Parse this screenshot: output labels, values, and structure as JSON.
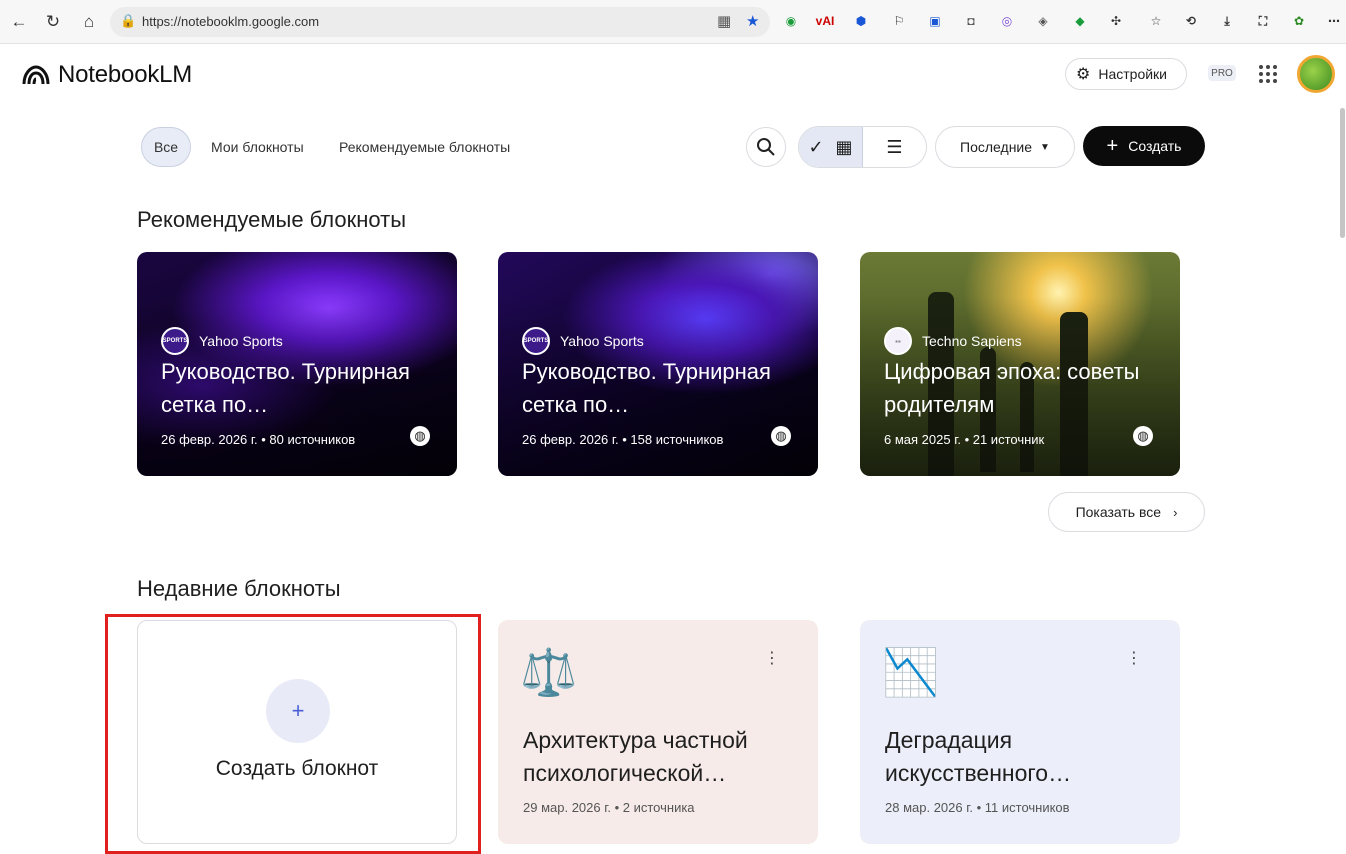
{
  "browser": {
    "url": "https://notebooklm.google.com",
    "ext_vai_label": "vAI"
  },
  "app": {
    "name": "NotebookLM",
    "settings_label": "Настройки",
    "pro_label": "PRO"
  },
  "toolbar": {
    "tabs": [
      {
        "label": "Все",
        "active": true
      },
      {
        "label": "Мои блокноты",
        "active": false
      },
      {
        "label": "Рекомендуемые блокноты",
        "active": false
      }
    ],
    "sort_label": "Последние",
    "create_label": "Создать"
  },
  "featured": {
    "title": "Рекомендуемые блокноты",
    "show_all_label": "Показать все",
    "cards": [
      {
        "source": "Yahoo Sports",
        "source_logo_text": "SPORTS",
        "title": "Руководство. Турнирная сетка по…",
        "meta": "26 февр. 2026 г. • 80 источников"
      },
      {
        "source": "Yahoo Sports",
        "source_logo_text": "SPORTS",
        "title": "Руководство. Турнирная сетка по…",
        "meta": "26 февр. 2026 г. • 158 источников"
      },
      {
        "source": "Techno Sapiens",
        "title": "Цифровая эпоха: советы родителям",
        "meta": "6 мая 2025 г. • 21 источник"
      }
    ]
  },
  "recent": {
    "title": "Недавние блокноты",
    "create_notebook_label": "Создать блокнот",
    "notebooks": [
      {
        "icon": "⚖️",
        "title": "Архитектура частной психологической…",
        "meta": "29 мар. 2026 г. • 2 источника"
      },
      {
        "icon": "📉",
        "title": "Деградация искусственного…",
        "meta": "28 мар. 2026 г. • 11 источников"
      }
    ]
  },
  "colors": {
    "accent_dark": "#0b0b0b",
    "highlight_red": "#e0201e",
    "card_pink": "#f6ebe8",
    "card_blue": "#eceef9"
  }
}
